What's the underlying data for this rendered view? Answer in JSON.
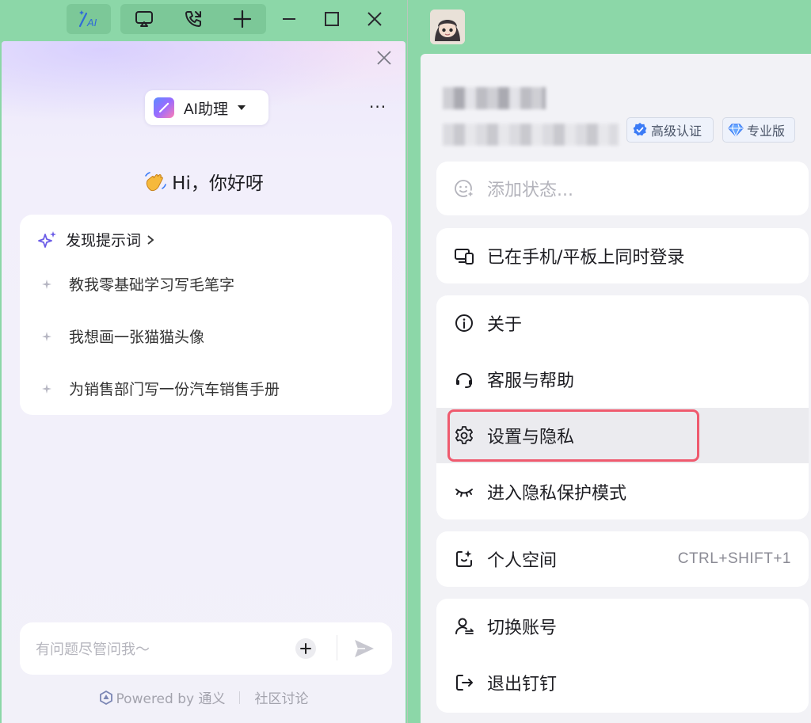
{
  "window": {
    "ai_toggle": "AI",
    "buttons": [
      "screen-share",
      "phone",
      "add",
      "minimize",
      "maximize",
      "close"
    ]
  },
  "assistant": {
    "selector_label": "AI助理",
    "greeting": "Hi，你好呀",
    "prompts_title": "发现提示词",
    "prompts": [
      "教我零基础学习写毛笔字",
      "我想画一张猫猫头像",
      "为销售部门写一份汽车销售手册"
    ],
    "input_placeholder": "有问题尽管问我～",
    "footer_powered": "Powered by 通义",
    "footer_community": "社区讨论"
  },
  "profile": {
    "badges": [
      "高级认证",
      "专业版"
    ],
    "status_placeholder": "添加状态...",
    "login_info": "已在手机/平板上同时登录",
    "menu": {
      "about": "关于",
      "help": "客服与帮助",
      "settings": "设置与隐私",
      "privacy_mode": "进入隐私保护模式"
    },
    "personal_space": "个人空间",
    "personal_space_shortcut": "CTRL+SHIFT+1",
    "switch_account": "切换账号",
    "logout": "退出钉钉"
  },
  "colors": {
    "titlebar_green": "#8cd7a8",
    "highlight_red": "#ef5a6e",
    "accent_blue": "#3b7bf6"
  }
}
